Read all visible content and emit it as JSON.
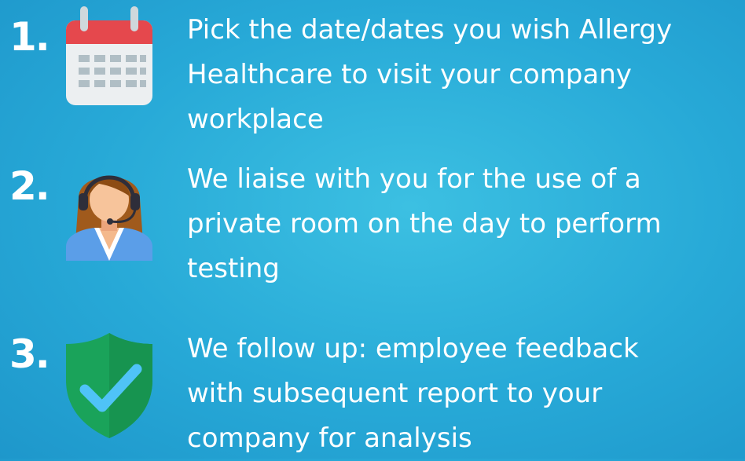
{
  "steps": [
    {
      "number": "1.",
      "icon": "calendar-icon",
      "lines": [
        "Pick the date/dates you wish Allergy",
        "Healthcare to visit your company",
        "workplace"
      ]
    },
    {
      "number": "2.",
      "icon": "support-agent-icon",
      "lines": [
        "We liaise with you for the use of a",
        "private room on the day to perform",
        "testing"
      ]
    },
    {
      "number": "3.",
      "icon": "shield-check-icon",
      "lines": [
        "We follow up: employee feedback",
        "with subsequent report to your",
        "company for analysis"
      ]
    }
  ],
  "colors": {
    "background": "#27a9d7",
    "text": "#ffffff",
    "calendar_red": "#e5484d",
    "shield_green": "#1aa35a",
    "check_blue": "#4fc3f7",
    "hair_brown": "#a05a1c",
    "headset_dark": "#2e2e3a"
  }
}
